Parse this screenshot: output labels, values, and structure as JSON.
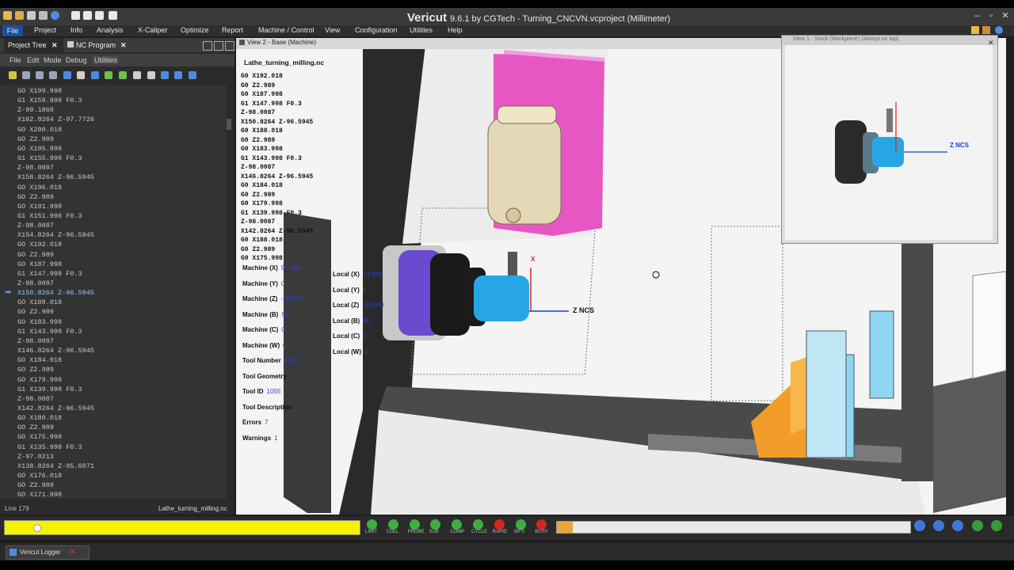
{
  "titlebar": {
    "app_name": "Vericut",
    "title": "9.6.1 by CGTech - Turning_CNCVN.vcproject (Millimeter)"
  },
  "menubar": [
    "File",
    "Project",
    "Info",
    "Analysis",
    "X-Caliper",
    "Optimize",
    "Report",
    "Machine / Control",
    "View",
    "Configuration",
    "Utilities",
    "Help"
  ],
  "left_panel": {
    "tabs": [
      "Project Tree",
      "NC Program"
    ],
    "submenu": [
      "File",
      "Edit",
      "Mode",
      "Debug",
      "Utilities"
    ],
    "code_lines": [
      "GO X199.998",
      "G1 X159.998 F0.3",
      "Z-99.1868",
      "X162.8264 Z-97.7726",
      "GO X200.018",
      "GO Z2.989",
      "GO X195.998",
      "G1 X155.998 F0.3",
      "Z-98.0087",
      "X158.8264 Z-96.5945",
      "GO X196.018",
      "GO Z2.989",
      "GO X191.998",
      "G1 X151.998 F0.3",
      "Z-98.0087",
      "X154.8264 Z-96.5945",
      "GO X192.018",
      "GO Z2.989",
      "GO X187.998",
      "G1 X147.998 F0.3",
      "Z-98.0087",
      "X150.8264 Z-96.5945",
      "GO X188.018",
      "GO Z2.989",
      "GO X183.998",
      "G1 X143.998 F0.3",
      "Z-98.0087",
      "X146.8264 Z-96.5945",
      "GO X184.018",
      "GO Z2.989",
      "GO X179.998",
      "G1 X139.998 F0.3",
      "Z-98.0087",
      "X142.8264 Z-96.5945",
      "GO X180.018",
      "GO Z2.989",
      "GO X175.998",
      "G1 X135.998 F0.3",
      "Z-97.0213",
      "X138.8264 Z-95.6071",
      "GO X176.018",
      "GO Z2.989",
      "GO X171.998"
    ],
    "current_line_index": 21,
    "status_line": "Line 179",
    "status_file": "Lathe_turning_milling.nc"
  },
  "viewport": {
    "tab_title": "View 2 - Base (Machine)",
    "program_name": "Lathe_turning_milling.nc",
    "overlay_code": [
      "G0 X192.018",
      "G0 Z2.989",
      "G0 X187.998",
      "G1 X147.998 F0.3",
      "Z-98.0087",
      "X150.8264 Z-96.5945",
      "G0 X188.018",
      "G0 Z2.989",
      "G0 X183.998",
      "G1 X143.998 F0.3",
      "Z-98.0087",
      "X146.8264 Z-96.5945",
      "G0 X184.018",
      "G0 Z2.989",
      "G0 X179.998",
      "G1 X139.998 F0.3",
      "Z-98.0087",
      "X142.8264 Z-96.5945",
      "G0 X188.018",
      "G0 Z2.989",
      "G0 X175.998"
    ],
    "machine": [
      {
        "label": "Machine (X)",
        "value": "97.388"
      },
      {
        "label": "Machine (Y)",
        "value": "0"
      },
      {
        "label": "Machine (Z)",
        "value": "-287.04"
      },
      {
        "label": "Machine (B)",
        "value": "90"
      },
      {
        "label": "Machine (C)",
        "value": "0"
      },
      {
        "label": "Machine (W)",
        "value": "0"
      },
      {
        "label": "Tool Number",
        "value": "1055"
      },
      {
        "label": "Tool Geometry",
        "value": ""
      },
      {
        "label": "Tool ID",
        "value": "1055"
      },
      {
        "label": "Tool Description",
        "value": ""
      },
      {
        "label": "Errors",
        "value": "7"
      },
      {
        "label": "Warnings",
        "value": "1"
      }
    ],
    "local": [
      {
        "label": "Local (X)",
        "value": "73.988"
      },
      {
        "label": "Local (Y)",
        "value": "0"
      },
      {
        "label": "Local (Z)",
        "value": "-98.009"
      },
      {
        "label": "Local (B)",
        "value": "90"
      },
      {
        "label": "Local (C)",
        "value": "0"
      },
      {
        "label": "Local (W)",
        "value": "0"
      }
    ],
    "axis_label": "Z NCS",
    "x_axis_label": "X"
  },
  "inset": {
    "title": "View 1 - Stock (Workpiece) (always on top)",
    "axis_label": "Z NCS"
  },
  "bottom": {
    "leds": [
      {
        "label": "LIMIT",
        "color": "#3fae3f"
      },
      {
        "label": "COLL",
        "color": "#3fae3f"
      },
      {
        "label": "PROBE",
        "color": "#3fae3f"
      },
      {
        "label": "SUB",
        "color": "#3fae3f"
      },
      {
        "label": "COMP",
        "color": "#3fae3f"
      },
      {
        "label": "CYCLE",
        "color": "#3fae3f"
      },
      {
        "label": "RAPID",
        "color": "#d62424"
      },
      {
        "label": "OPTI",
        "color": "#3fae3f"
      },
      {
        "label": "BUSY",
        "color": "#d62424"
      }
    ],
    "progress_fraction": 0.045,
    "logger_label": "Vericut Logger"
  },
  "colors": {
    "accent": "#1b4f9c",
    "yellow": "#f7f300",
    "pink": "#e657c4",
    "cyan": "#27a6e6",
    "orange": "#f29d2a"
  }
}
